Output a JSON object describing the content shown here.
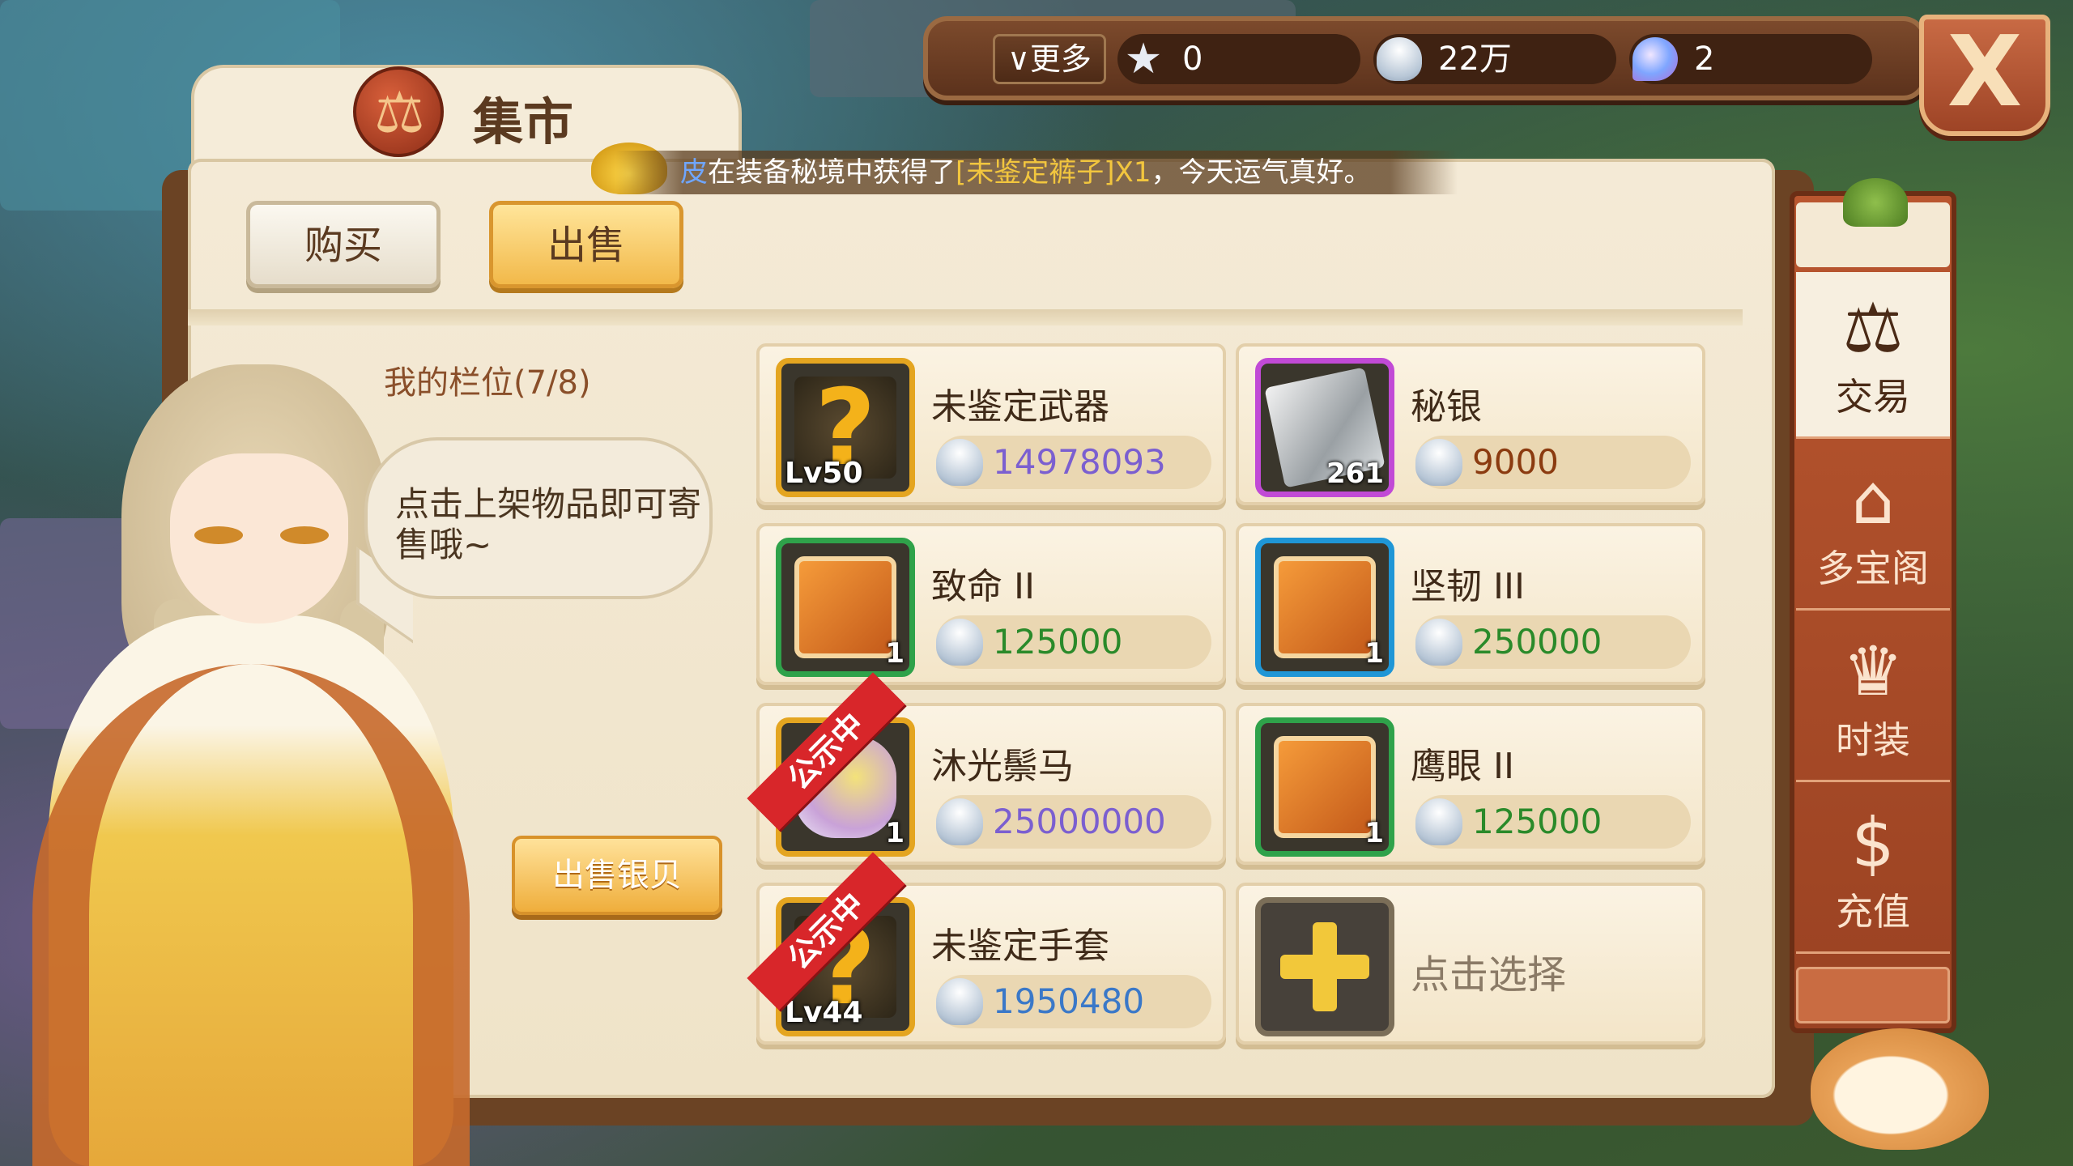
{
  "currency": {
    "more_label": "更多",
    "star_value": "0",
    "shell_value": "22万",
    "gem_value": "2",
    "icons": [
      "star-icon",
      "shell-icon",
      "gem-icon"
    ]
  },
  "close_label": "X",
  "title": "集市",
  "banner": {
    "who": "皮",
    "text_a": "在装备秘境中获得了",
    "item": "[未鉴定裤子]X1",
    "text_b": "，今天运气真好。"
  },
  "tabs": {
    "buy": "购买",
    "sell": "出售"
  },
  "slots_label": "我的栏位(7/8)",
  "bubble_text": "点击上架物品即可寄售哦~",
  "sell_silver_label": "出售银贝",
  "items": [
    {
      "name": "未鉴定武器",
      "badge": "Lv50",
      "count": "",
      "price": "14978093",
      "ribbon": "",
      "price_color": "#7b5fd0"
    },
    {
      "name": "秘银",
      "badge": "",
      "count": "261",
      "price": "9000",
      "ribbon": "",
      "price_color": "#8b3b10"
    },
    {
      "name": "致命 II",
      "badge": "",
      "count": "1",
      "price": "125000",
      "ribbon": "",
      "price_color": "#2a8a2a"
    },
    {
      "name": "坚韧 III",
      "badge": "",
      "count": "1",
      "price": "250000",
      "ribbon": "",
      "price_color": "#2a8a2a"
    },
    {
      "name": "沐光鬃马",
      "badge": "",
      "count": "1",
      "price": "25000000",
      "ribbon": "公示中",
      "price_color": "#7b5fd0"
    },
    {
      "name": "鹰眼 II",
      "badge": "",
      "count": "1",
      "price": "125000",
      "ribbon": "",
      "price_color": "#2a8a2a"
    },
    {
      "name": "未鉴定手套",
      "badge": "Lv44",
      "count": "",
      "price": "1950480",
      "ribbon": "公示中",
      "price_color": "#3a78c8"
    }
  ],
  "empty_slot_label": "点击选择",
  "sidebar": [
    {
      "label": "交易",
      "icon": "scale-icon",
      "active": true
    },
    {
      "label": "多宝阁",
      "icon": "treasure-chest-icon",
      "active": false
    },
    {
      "label": "时装",
      "icon": "outfit-icon",
      "active": false
    },
    {
      "label": "充值",
      "icon": "dollar-icon",
      "active": false
    }
  ]
}
